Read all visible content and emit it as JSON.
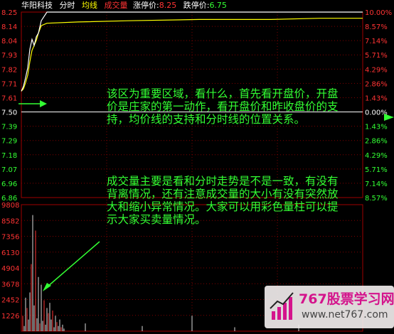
{
  "header": {
    "stock_name": "华阳科技",
    "tab_time": "分时",
    "tab_avg": "均线",
    "tab_volume": "成交量",
    "limit_up_label": "涨停价:",
    "limit_up_value": "8.25",
    "limit_down_label": "跌停价:",
    "limit_down_value": "6.75"
  },
  "price_axis": [
    "8.25",
    "8.14",
    "8.04",
    "7.93",
    "7.82",
    "7.71",
    "7.61",
    "7.50",
    "7.39",
    "7.29",
    "7.18",
    "7.07",
    "6.96",
    "6.86"
  ],
  "pct_axis": [
    "10.00%",
    "8.57%",
    "7.14%",
    "5.71%",
    "4.29%",
    "2.86%",
    "1.43%",
    "0.00%",
    "1.43%",
    "2.86%",
    "4.29%",
    "5.71%",
    "7.14%",
    "8.57%"
  ],
  "volume_axis": [
    "9808",
    "8582",
    "7356",
    "6130",
    "4904",
    "3678",
    "2452",
    "1226"
  ],
  "notes": {
    "note1": "该区为重要区域，看什么，首先看开盘价，开盘价是庄家的第一动作，看开盘价和昨收盘价的支持，均价线的支持和分时线的位置关系。",
    "note2": "成交量主要是看和分时走势是不是一致，有没有背离情况，还有注意成交量的大小有没有突然放大和缩小异常情况。大家可以用彩色量柱可以提示大家买卖量情况。"
  },
  "watermark": {
    "brand": "767股票学习网",
    "site": "www.net767.com"
  },
  "colors": {
    "background": "#000000",
    "price_line": "#ffffff",
    "avg_line": "#ffff00",
    "up_red": "#ff3333",
    "grid": "#8b0000",
    "annotation": "#33ff33"
  },
  "chart_data": {
    "type": "line",
    "prev_close": 7.5,
    "limit_up": 8.25,
    "limit_down": 6.75,
    "price_series": [
      7.61,
      7.65,
      7.72,
      7.8,
      7.95,
      8.03,
      7.98,
      8.05,
      8.08,
      8.18,
      8.25,
      8.25,
      8.25,
      8.25,
      8.25,
      8.25,
      8.25
    ],
    "avg_series": [
      7.61,
      7.63,
      7.68,
      7.74,
      7.85,
      7.94,
      7.98,
      8.02,
      8.08,
      8.14,
      8.16,
      8.17,
      8.18,
      8.19,
      8.19,
      8.2,
      8.2
    ],
    "volume_ylim": [
      0,
      9808
    ]
  }
}
